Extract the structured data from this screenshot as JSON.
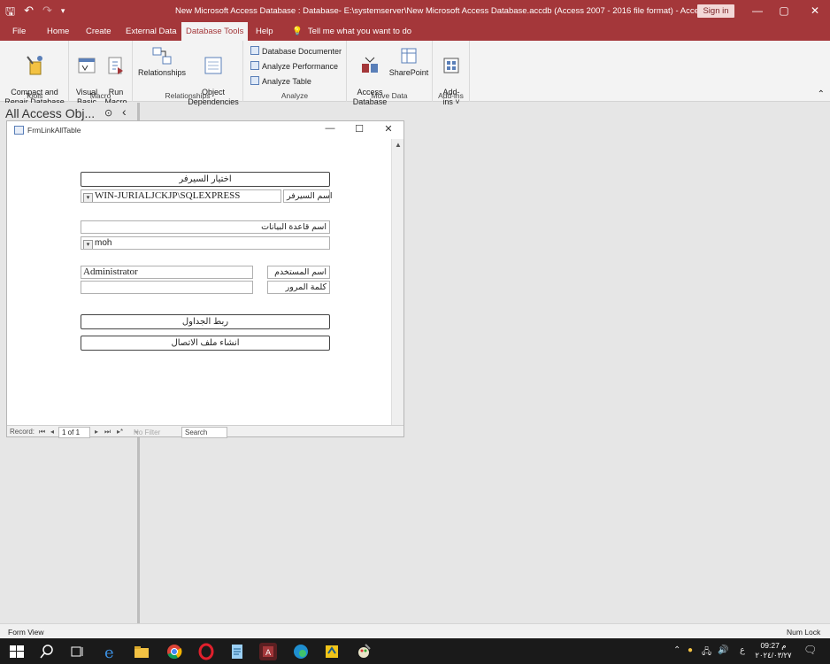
{
  "titlebar": {
    "title": "New Microsoft Access Database : Database- E:\\systemserver\\New Microsoft Access Database.accdb (Access 2007 - 2016 file format)  -  Access",
    "sign_in": "Sign in",
    "minimize": "—",
    "restore": "▢",
    "close": "✕"
  },
  "tabs": [
    "File",
    "Home",
    "Create",
    "External Data",
    "Database Tools",
    "Help"
  ],
  "active_tab": "Database Tools",
  "tell_me": "Tell me what you want to do",
  "ribbon": {
    "tools": {
      "label": "Tools",
      "compact": "Compact and\nRepair Database"
    },
    "macro": {
      "label": "Macro",
      "visual_basic": "Visual\nBasic",
      "run_macro": "Run\nMacro"
    },
    "relationships": {
      "label": "Relationships",
      "relationships": "Relationships",
      "object_deps": "Object\nDependencies"
    },
    "analyze": {
      "label": "Analyze",
      "documenter": "Database Documenter",
      "performance": "Analyze Performance",
      "table": "Analyze Table"
    },
    "move_data": {
      "label": "Move Data",
      "access_db": "Access\nDatabase",
      "sharepoint": "SharePoint"
    },
    "addins": {
      "label": "Add-ins",
      "addins_btn": "Add-\nins ˅"
    }
  },
  "nav": {
    "header": "All Access Obj...",
    "menu_icon": "⊙",
    "collapse_icon": "‹"
  },
  "form": {
    "title": "FrmLinkAllTable",
    "minimize": "—",
    "maximize": "☐",
    "close": "✕",
    "choose_server_btn": "اختيار السيرفر",
    "server_value": "WIN-JURIALJCKJP\\SQLEXPRESS",
    "server_label": "اسم السيرفر",
    "db_name_label": "اسم قاعدة البيانات",
    "db_value": "moh",
    "username_value": "Administrator",
    "username_label": "اسم المستخدم",
    "password_value": "",
    "password_label": "كلمة المرور",
    "link_tables_btn": "ربط الجداول",
    "create_conn_btn": "انشاء ملف الاتصال",
    "record_nav": {
      "label": "Record:",
      "first": "⏮",
      "prev": "◂",
      "position": "1 of 1",
      "next": "▸",
      "last": "⏭",
      "new": "▸*",
      "filter": "No Filter",
      "search": "Search"
    }
  },
  "statusbar": {
    "left": "Form View",
    "right": "Num Lock"
  },
  "taskbar": {
    "tray_lang": "ع",
    "time": "09:27 م",
    "date": "٢٠٢٤/٠٣/٢٧"
  }
}
